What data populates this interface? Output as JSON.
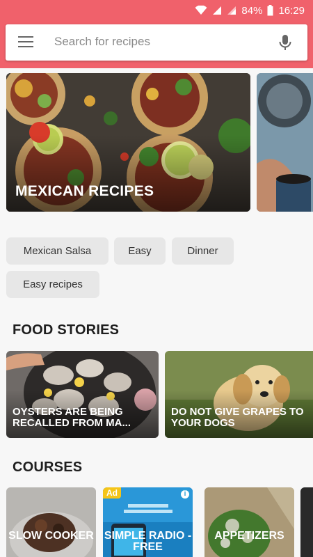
{
  "status_bar": {
    "battery": "84%",
    "time": "16:29"
  },
  "search": {
    "placeholder": "Search for recipes"
  },
  "hero": {
    "title": "MEXICAN RECIPES"
  },
  "chips": [
    "Mexican Salsa",
    "Easy",
    "Dinner",
    "Easy recipes"
  ],
  "food_stories": {
    "title": "FOOD STORIES",
    "items": [
      {
        "label": "OYSTERS ARE BEING RECALLED FROM MA..."
      },
      {
        "label": "DO NOT GIVE GRAPES TO YOUR DOGS"
      }
    ]
  },
  "courses": {
    "title": "COURSES",
    "items": [
      {
        "label": "SLOW COOKER"
      },
      {
        "label": "SIMPLE RADIO - FREE",
        "badge": "Ad"
      },
      {
        "label": "APPETIZERS"
      }
    ]
  },
  "colors": {
    "accent": "#f0616b",
    "chip_bg": "#e7e7e7"
  }
}
